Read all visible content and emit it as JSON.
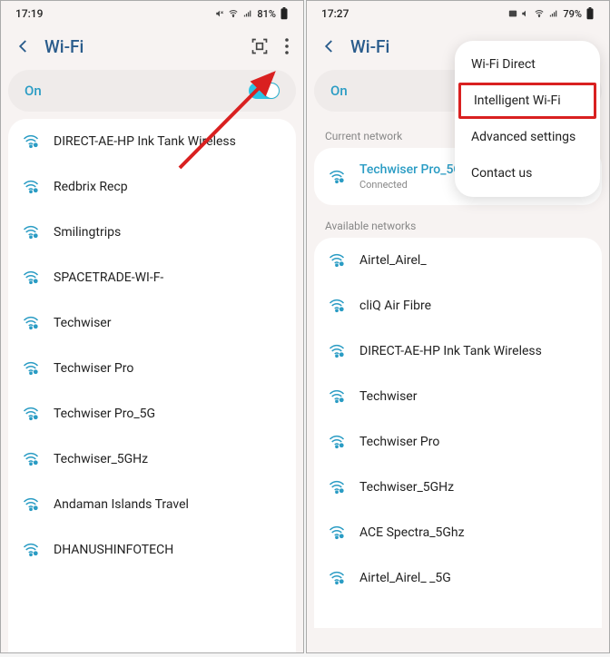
{
  "left": {
    "status": {
      "time": "17:19",
      "battery": "81%"
    },
    "title": "Wi-Fi",
    "on_label": "On",
    "networks": [
      "DIRECT-AE-HP Ink Tank Wireless",
      "Redbrix Recp",
      "Smilingtrips",
      "SPACETRADE-WI-F-",
      "Techwiser",
      "Techwiser Pro",
      "Techwiser Pro_5G",
      "Techwiser_5GHz",
      "Andaman Islands Travel",
      "DHANUSHINFOTECH"
    ]
  },
  "right": {
    "status": {
      "time": "17:27",
      "battery": "79%"
    },
    "title": "Wi-Fi",
    "on_label": "On",
    "section_current": "Current network",
    "section_available": "Available networks",
    "connected": {
      "name": "Techwiser Pro_5G",
      "status": "Connected"
    },
    "networks": [
      "Airtel_Airel_",
      "cliQ Air Fibre",
      "DIRECT-AE-HP Ink Tank Wireless",
      "Techwiser",
      "Techwiser Pro",
      "Techwiser_5GHz",
      "ACE Spectra_5Ghz",
      "Airtel_Airel_                    _5G"
    ],
    "menu": {
      "items": [
        "Wi-Fi Direct",
        "Intelligent Wi-Fi",
        "Advanced settings",
        "Contact us"
      ],
      "highlight_index": 1
    }
  }
}
